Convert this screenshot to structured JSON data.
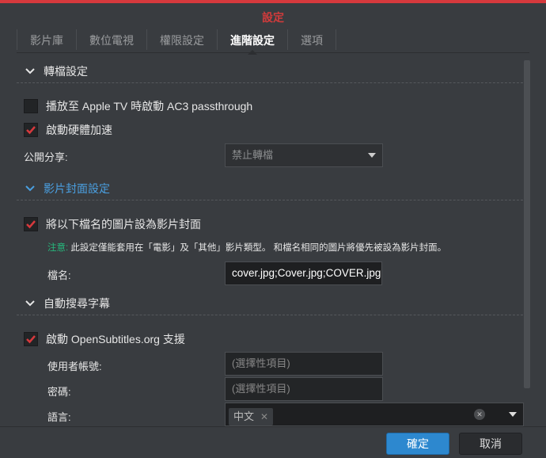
{
  "window": {
    "title": "設定"
  },
  "tabs": [
    {
      "label": "影片庫"
    },
    {
      "label": "數位電視"
    },
    {
      "label": "權限設定"
    },
    {
      "label": "進階設定"
    },
    {
      "label": "選項"
    }
  ],
  "transcode": {
    "title": "轉檔設定",
    "ac3_label": "播放至 Apple TV 時啟動 AC3 passthrough",
    "ac3_checked": false,
    "hw_label": "啟動硬體加速",
    "hw_checked": true,
    "share_label": "公開分享:",
    "share_value": "禁止轉檔"
  },
  "cover": {
    "title": "影片封面設定",
    "enable_label": "將以下檔名的圖片設為影片封面",
    "enable_checked": true,
    "note_prefix": "注意:",
    "note_text": " 此設定僅能套用在「電影」及「其他」影片類型。 和檔名相同的圖片將優先被設為影片封面。",
    "filename_label": "檔名:",
    "filename_value": "cover.jpg;Cover.jpg;COVER.jpg;folder.jpg;Folder.jpg"
  },
  "subtitles": {
    "title": "自動搜尋字幕",
    "enable_label": "啟動 OpenSubtitles.org 支援",
    "enable_checked": true,
    "user_label": "使用者帳號:",
    "user_placeholder": "(選擇性項目)",
    "pass_label": "密碼:",
    "pass_placeholder": "(選擇性項目)",
    "lang_label": "語言:",
    "lang_tags": [
      "中文"
    ]
  },
  "footer": {
    "ok": "確定",
    "cancel": "取消"
  },
  "colors": {
    "accent": "#2d88cf",
    "title": "#d23b3b",
    "check": "#d6393d",
    "note": "#26b77c"
  }
}
